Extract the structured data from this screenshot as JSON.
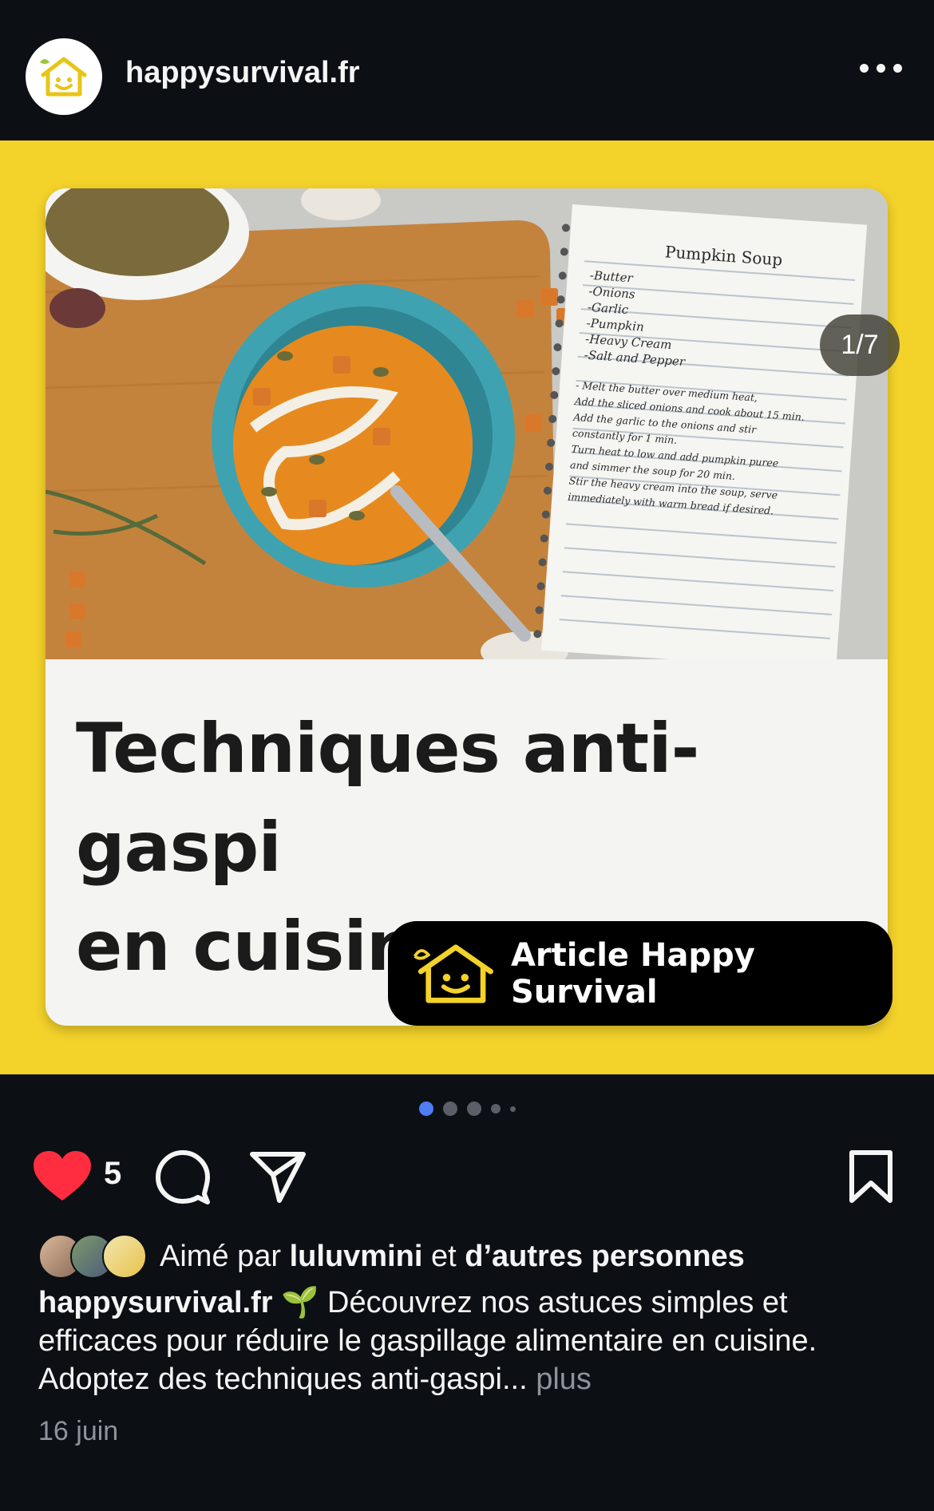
{
  "header": {
    "username": "happysurvival.fr",
    "avatar_icon": "happy-house-logo-icon",
    "menu_icon": "more-options-icon"
  },
  "post": {
    "counter": "1/7",
    "card_title_line1": "Techniques anti-gaspi",
    "card_title_line2": "en cuisine",
    "badge_text": "Article Happy Survival",
    "notebook": {
      "heading": "Pumpkin Soup",
      "ingredients": [
        "-Butter",
        "-Onions",
        "-Garlic",
        "-Pumpkin",
        "-Heavy Cream",
        "-Salt and Pepper"
      ],
      "steps": [
        "- Melt the butter over medium heat,",
        "Add the sliced onions and cook about 15 min.",
        "Add the garlic to the onions and stir",
        "constantly for 1 min.",
        "Turn heat to low and add pumpkin puree",
        "and simmer the soup for 20 min.",
        "Stir the heavy cream into the soup, serve",
        "immediately with warm bread if desired."
      ]
    },
    "carousel_total": 7,
    "carousel_active": 1
  },
  "actions": {
    "like_icon": "heart-filled-icon",
    "like_count": "5",
    "comment_icon": "comment-icon",
    "share_icon": "send-icon",
    "save_icon": "bookmark-icon"
  },
  "likes": {
    "prefix": "Aimé par",
    "user": "luluvmini",
    "middle": "et",
    "others": "d’autres personnes"
  },
  "caption": {
    "username": "happysurvival.fr",
    "emoji": "🌱",
    "text": "Découvrez nos astuces simples et efficaces pour réduire le gaspillage alimentaire en cuisine. Adoptez des techniques anti-gaspi...",
    "more": "plus"
  },
  "date": "16 juin",
  "colors": {
    "background": "#0c0f14",
    "brand_yellow": "#f3d22a",
    "like_red": "#ff2d3f",
    "active_dot": "#4f7cf7"
  }
}
